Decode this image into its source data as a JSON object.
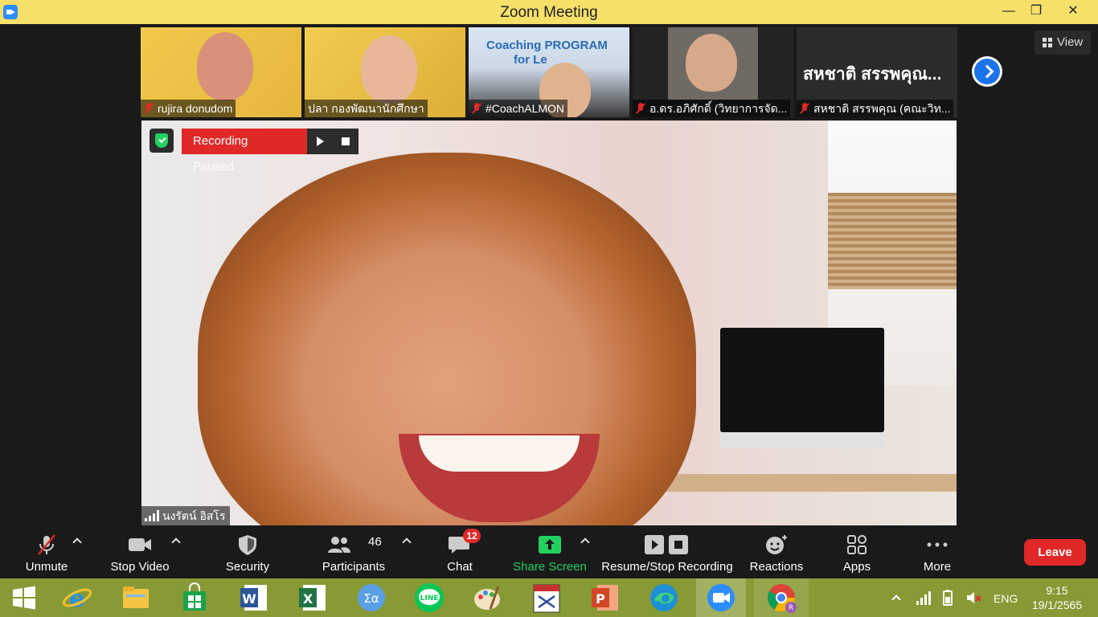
{
  "window": {
    "title": "Zoom Meeting",
    "minimize": "—",
    "maximize": "❐",
    "close": "✕"
  },
  "view_button": {
    "label": "View"
  },
  "participants_strip": [
    {
      "name": "rujira donudom",
      "muted": true
    },
    {
      "name": "ปลา กองพัฒนานักศึกษา",
      "muted": false
    },
    {
      "name": "#CoachALMON",
      "muted": true
    },
    {
      "name": "อ.ดร.อภิศักดิ์ (วิทยาการจัด...",
      "muted": true
    },
    {
      "name": "สหชาติ สรรพคุณ (คณะวิท...",
      "muted": true,
      "big_name": "สหชาติ สรรพคุณ..."
    }
  ],
  "thumb3_overlay": {
    "line1": "Coaching PROGRAM",
    "line2": "for Le"
  },
  "recording": {
    "status": "Recording Paused"
  },
  "speaker": {
    "name": "นงรัตน์ อิสโร"
  },
  "toolbar": {
    "unmute": "Unmute",
    "stop_video": "Stop Video",
    "security": "Security",
    "participants": "Participants",
    "participants_count": "46",
    "chat": "Chat",
    "chat_badge": "12",
    "share_screen": "Share Screen",
    "resume_stop_recording": "Resume/Stop Recording",
    "reactions": "Reactions",
    "apps": "Apps",
    "more": "More",
    "leave": "Leave"
  },
  "taskbar": {
    "language": "ENG",
    "time": "9:15",
    "date": "19/1/2565",
    "apps": [
      "start",
      "internet-explorer",
      "file-explorer",
      "store",
      "word",
      "excel",
      "math-input",
      "line",
      "paint",
      "lisrel",
      "powerpoint",
      "edge",
      "zoom",
      "chrome"
    ]
  },
  "colors": {
    "titlebar": "#f7e06a",
    "accent": "#2d8cff",
    "leave": "#e02828",
    "share": "#23d160",
    "taskbar": "#879a35"
  }
}
